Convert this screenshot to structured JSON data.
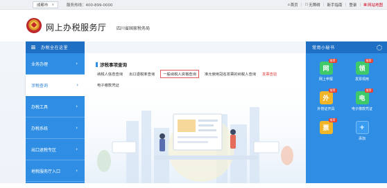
{
  "topbar": {
    "city": "成都市",
    "hotline": "服务热线：400-899-0000",
    "links": [
      "首页",
      "无障碍",
      "新手指南",
      "登录",
      "网站地图"
    ]
  },
  "header": {
    "title": "网上办税服务厅",
    "subtitle": "四川省国家税务局"
  },
  "nav": {
    "heading": "办税全在这里",
    "items": [
      {
        "label": "业务办理",
        "active": false
      },
      {
        "label": "涉税查询",
        "active": true
      },
      {
        "label": "办税工具",
        "active": false
      },
      {
        "label": "办税系统",
        "active": false
      },
      {
        "label": "出口退税专区",
        "active": false
      },
      {
        "label": "地税服务厅入口",
        "active": false
      }
    ]
  },
  "section": {
    "title": "涉税事项查询",
    "links": [
      {
        "label": "纳税人信息查询",
        "style": "normal"
      },
      {
        "label": "出口退税率查询",
        "style": "normal"
      },
      {
        "label": "一般纳税人资格查询",
        "style": "boxed"
      },
      {
        "label": "准允使用冠名发票的纳税人查询",
        "style": "normal"
      },
      {
        "label": "发票查验",
        "style": "red"
      },
      {
        "label": "电子缴款凭证",
        "style": "normal"
      }
    ]
  },
  "secretary": {
    "heading": "常用小秘书",
    "apps": [
      {
        "label": "网上申报",
        "glyph": "网",
        "color": "#3ec96a",
        "badge": "推荐"
      },
      {
        "label": "发票领用",
        "glyph": "领",
        "color": "#3ec96a",
        "badge": "推荐"
      },
      {
        "label": "外管证开具",
        "glyph": "外",
        "color": "#f0b529",
        "badge": "推荐"
      },
      {
        "label": "电子缴款凭证",
        "glyph": "电",
        "color": "#3ec96a",
        "badge": "推荐"
      },
      {
        "label": "",
        "glyph": "票",
        "color": "#f0b529",
        "badge": "推荐"
      },
      {
        "label": "添加",
        "glyph": "+",
        "color": "#3a9cf0",
        "badge": ""
      }
    ]
  }
}
